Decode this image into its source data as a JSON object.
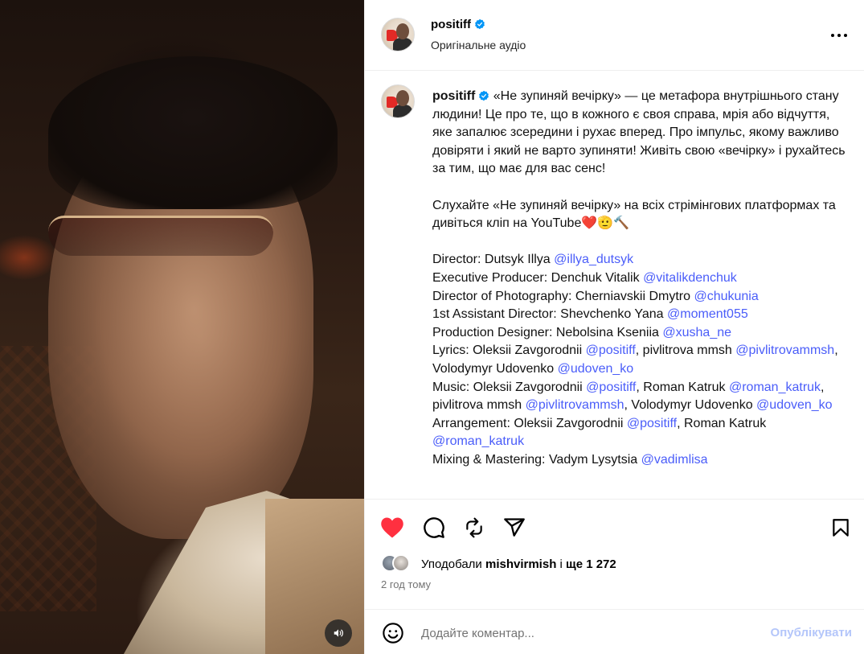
{
  "post": {
    "username": "positiff",
    "audio": "Оригінальне аудіо",
    "verified_icon": "verified-badge-icon",
    "more_icon": "more-options-icon"
  },
  "caption": {
    "username": "positiff",
    "text1": "«Не зупиняй вечірку» — це метафора внутрішнього стану людини! Це про те, що в кожного є своя справа, мрія або відчуття, яке запалює зсередини і рухає вперед. Про імпульс, якому важливо довіряти і який не варто зупиняти! Живіть свою «вечірку» і рухайтесь за тим, що має для вас сенс!",
    "text2": "Слухайте «Не зупиняй вечірку» на всіх стрімінгових платформах та дивіться кліп на YouTube",
    "text2_emojis": "❤️🫡🔨",
    "credits": [
      {
        "label": "Director: Dutsyk Illya ",
        "mentions": [
          "@illya_dutsyk"
        ],
        "text": [
          "",
          ""
        ]
      },
      {
        "label": "Executive Producer: Denchuk Vitalik ",
        "mentions": [
          "@vitalikdenchuk"
        ],
        "text": [
          "",
          ""
        ]
      },
      {
        "label": "Director of Photography: Cherniavskii Dmytro ",
        "mentions": [
          "@chukunia"
        ],
        "text": [
          "",
          ""
        ]
      },
      {
        "label": "1st Assistant Director: Shevchenko Yana ",
        "mentions": [
          "@moment055"
        ],
        "text": [
          "",
          ""
        ]
      },
      {
        "label": "Production Designer: Nebolsina Kseniia ",
        "mentions": [
          "@xusha_ne"
        ],
        "text": [
          "",
          ""
        ]
      },
      {
        "label": "Lyrics: Oleksii Zavgorodnii ",
        "mentions": [
          "@positiff",
          "@pivlitrovammsh",
          "@udoven_ko"
        ],
        "text": [
          ", pivlitrova mmsh ",
          ", Volodymyr Udovenko ",
          ""
        ]
      },
      {
        "label": "Music: Oleksii Zavgorodnii ",
        "mentions": [
          "@positiff",
          "@roman_katruk",
          "@pivlitrovammsh",
          "@udoven_ko"
        ],
        "text": [
          ", Roman Katruk ",
          ", pivlitrova mmsh ",
          ", Volodymyr Udovenko ",
          ""
        ]
      },
      {
        "label": "Arrangement: Oleksii Zavgorodnii ",
        "mentions": [
          "@positiff",
          "@roman_katruk"
        ],
        "text": [
          ", Roman Katruk ",
          ""
        ]
      },
      {
        "label": "Mixing & Mastering: Vadym Lysytsia ",
        "mentions": [
          "@vadimlisa"
        ],
        "text": [
          "",
          ""
        ]
      }
    ]
  },
  "actions": {
    "like_icon": "heart-filled-icon",
    "comment_icon": "comment-icon",
    "repost_icon": "repost-icon",
    "share_icon": "share-icon",
    "save_icon": "bookmark-icon",
    "like_color": "#ff3040"
  },
  "likes": {
    "prefix": "Уподобали ",
    "user": "mishvirmish",
    "middle": " і ",
    "rest": "ще 1 272"
  },
  "time": "2 год тому",
  "comment": {
    "placeholder": "Додайте коментар...",
    "publish": "Опублікувати",
    "emoji_icon": "emoji-icon"
  },
  "media": {
    "sound_icon": "speaker-icon"
  }
}
